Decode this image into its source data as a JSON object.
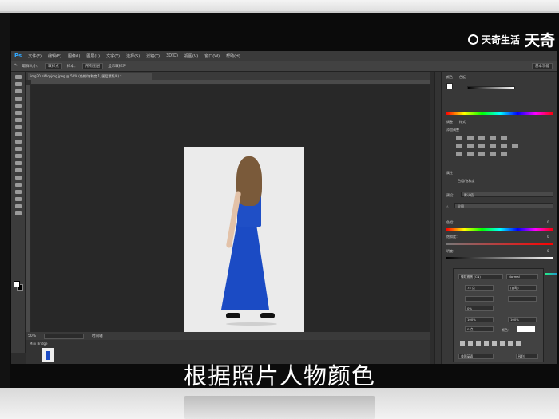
{
  "watermark": {
    "brand": "天奇生活",
    "brand_big": "天奇"
  },
  "app": {
    "logo": "Ps",
    "menu": [
      "文件(F)",
      "编辑(E)",
      "图像(I)",
      "图层(L)",
      "文字(Y)",
      "选择(S)",
      "滤镜(T)",
      "3D(D)",
      "视图(V)",
      "窗口(W)",
      "帮助(H)"
    ],
    "options": {
      "sample_size": "取样大小：",
      "sample_value": "取样点",
      "sample_label": "样本：",
      "sample_layers": "所有图层",
      "show_ring": "显示取样环",
      "workspace": "基本功能"
    },
    "document_tab": "img30.hl6lqyjmg.jpeg @ 50% (色相/饱和度 1, 图层蒙版/8) *",
    "status": {
      "zoom": "50%",
      "info": "时间轴",
      "timeline_tab": "Mini Bridge"
    }
  },
  "panels": {
    "color_tab": "颜色",
    "swatches_tab": "色板",
    "adjust_tab": "调整",
    "styles_tab": "样式",
    "add_adjustment": "添加调整",
    "properties_tab": "属性",
    "hue_sat_title": "色相/饱和度",
    "preset_label": "预设：",
    "preset_value": "默认值",
    "channel_value": "全图",
    "hue_label": "色相：",
    "hue_value": "0",
    "saturation_label": "饱和度：",
    "saturation_value": "0",
    "lightness_label": "明度：",
    "lightness_value": "0"
  },
  "character": {
    "font": "微软雅黑 (CN)",
    "style": "Normal",
    "size": "75 点",
    "leading": "(自动)",
    "tracking": "0%",
    "vscale": "100%",
    "hscale": "100%",
    "baseline": "0 点",
    "color_label": "颜色：",
    "lang": "美国英语",
    "aa": "锐利"
  },
  "subtitle": "根据照片人物颜色"
}
